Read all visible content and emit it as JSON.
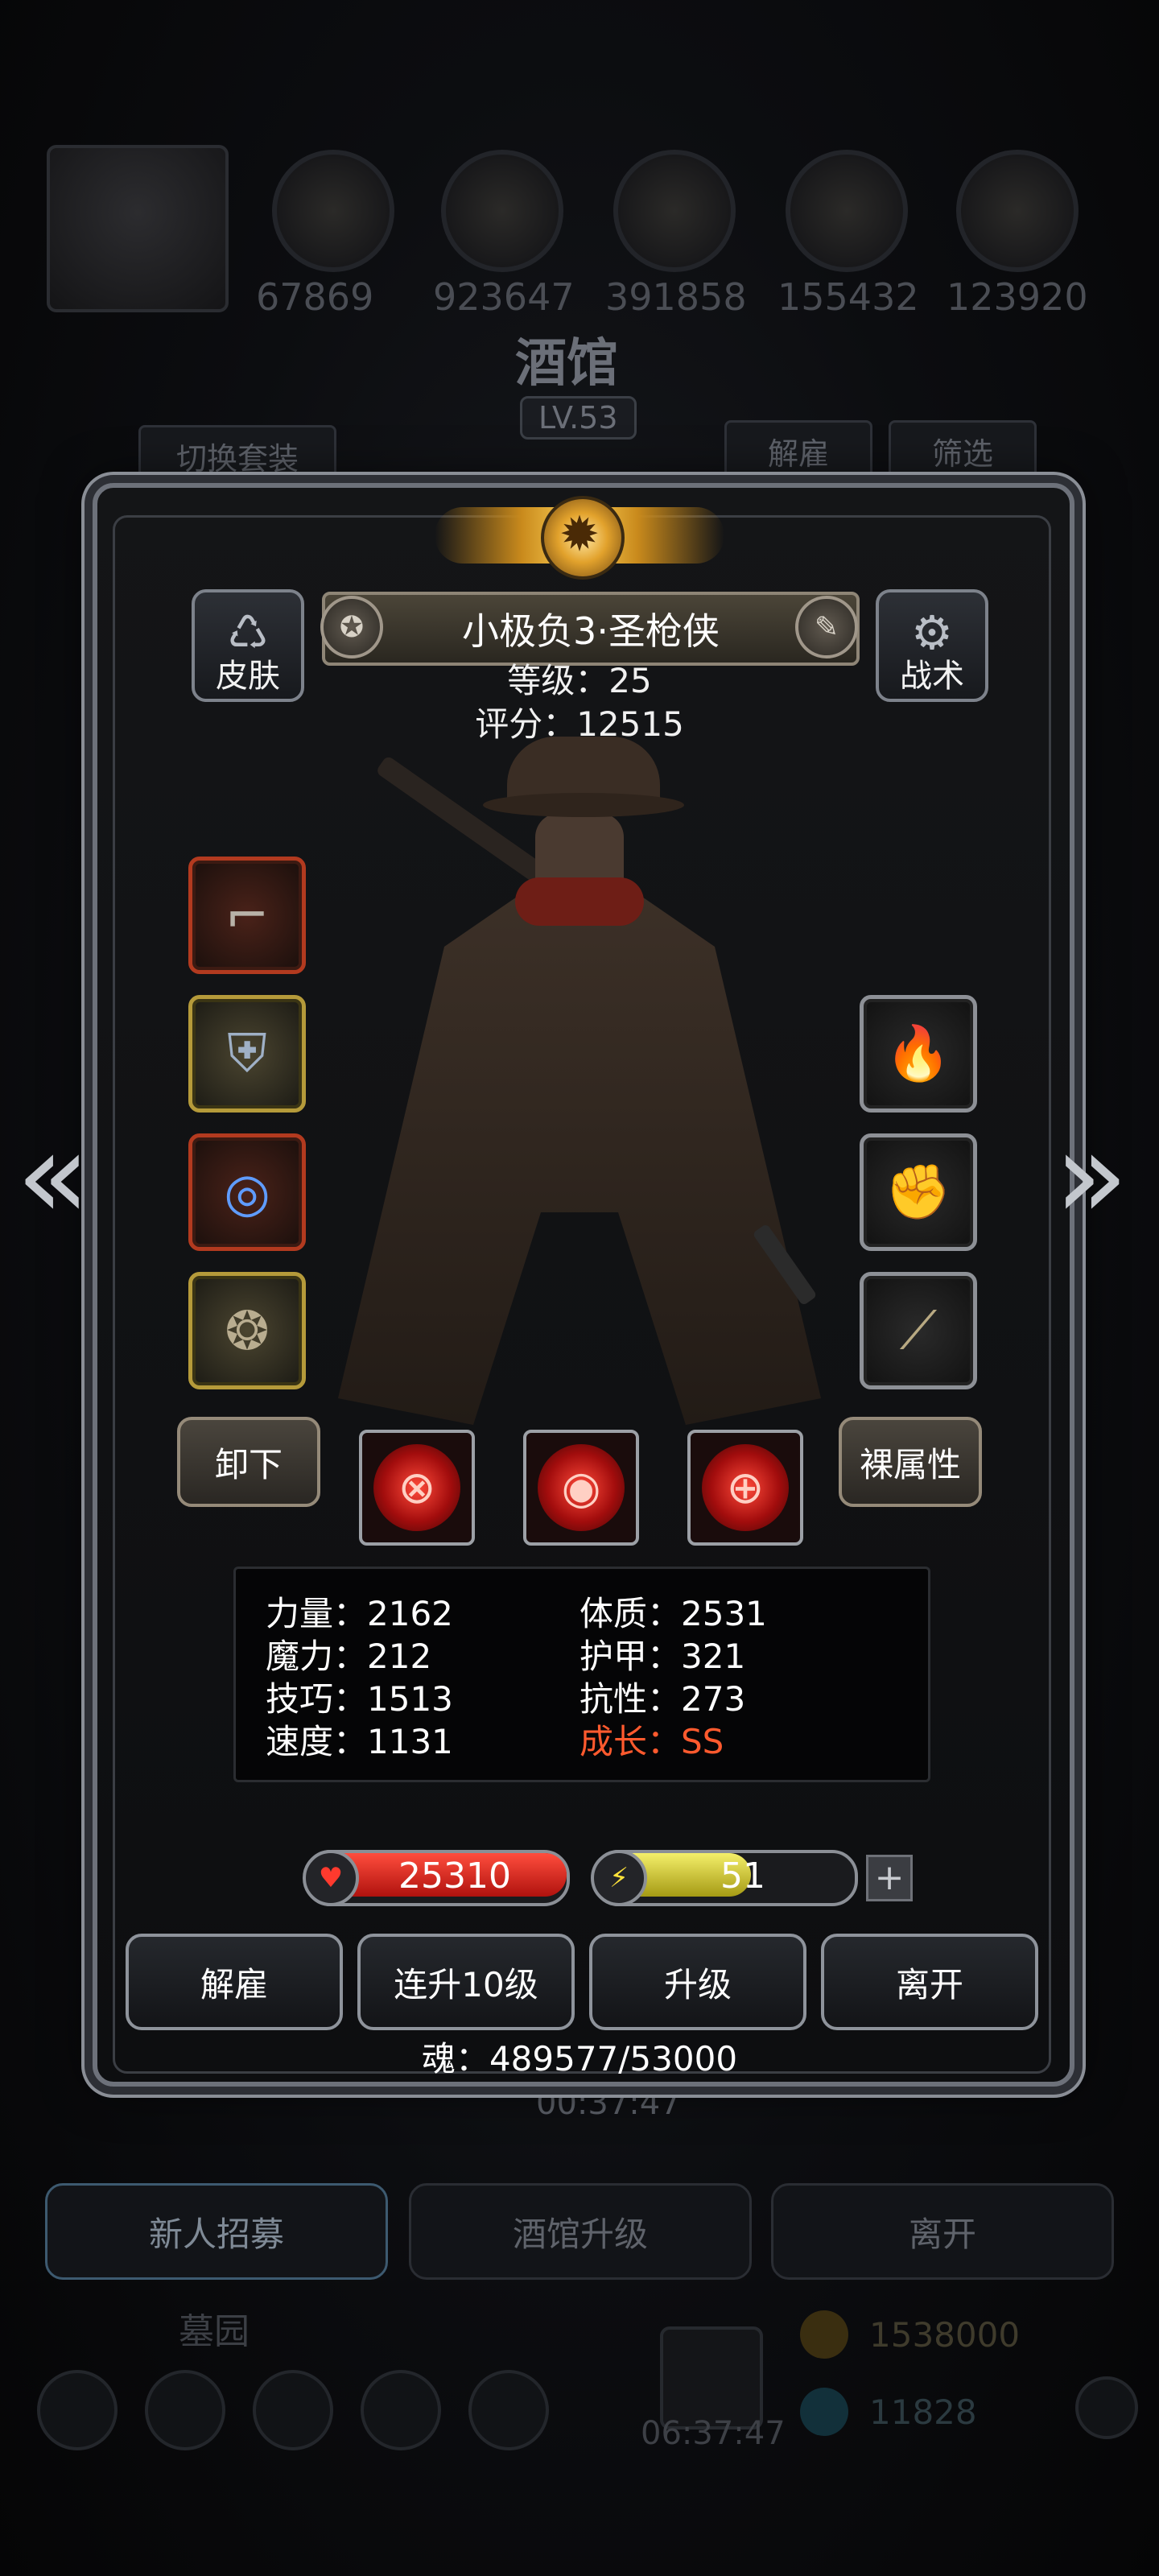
{
  "background": {
    "resources": [
      "67869",
      "923647",
      "391858",
      "155432",
      "123920"
    ],
    "title": "酒馆",
    "level": "LV.53",
    "switch_outfit": "切换套装",
    "fire": "解雇",
    "filter": "筛选",
    "timer": "00:37:47",
    "tabs": [
      "新人招募",
      "酒馆升级",
      "离开"
    ],
    "cemetery": "墓园",
    "gold": "1538000",
    "gems": "11828",
    "gift_timer": "06:37:47"
  },
  "hero": {
    "skin_label": "皮肤",
    "tactics_label": "战术",
    "name": "小极负3·圣枪侠",
    "level_line": "等级：25",
    "score_line": "评分：12515"
  },
  "equipment": {
    "left": [
      "pistol-icon",
      "armor-icon",
      "amulet-icon",
      "ring-icon"
    ],
    "right": [
      "fire-rune-icon",
      "gauntlet-icon",
      "scroll-icon"
    ]
  },
  "controls": {
    "unequip": "卸下",
    "naked_attr": "裸属性"
  },
  "skills": [
    "crosshair-skill-icon",
    "vortex-skill-icon",
    "target-skill-icon"
  ],
  "stats": {
    "left": [
      "力量：2162",
      "魔力：212",
      "技巧：1513",
      "速度：1131"
    ],
    "right": [
      "体质：2531",
      "护甲：321",
      "抗性：273"
    ],
    "growth": "成长：SS"
  },
  "bars": {
    "hp": "25310",
    "hp_fraction": 1.0,
    "energy": "51",
    "energy_fraction": 0.6
  },
  "actions": [
    "解雇",
    "连升10级",
    "升级",
    "离开"
  ],
  "soul": "魂：489577/53000",
  "colors": {
    "accent_red": "#ff5a2e",
    "hp_red": "#d42a22",
    "energy_yellow": "#e3db3c"
  }
}
